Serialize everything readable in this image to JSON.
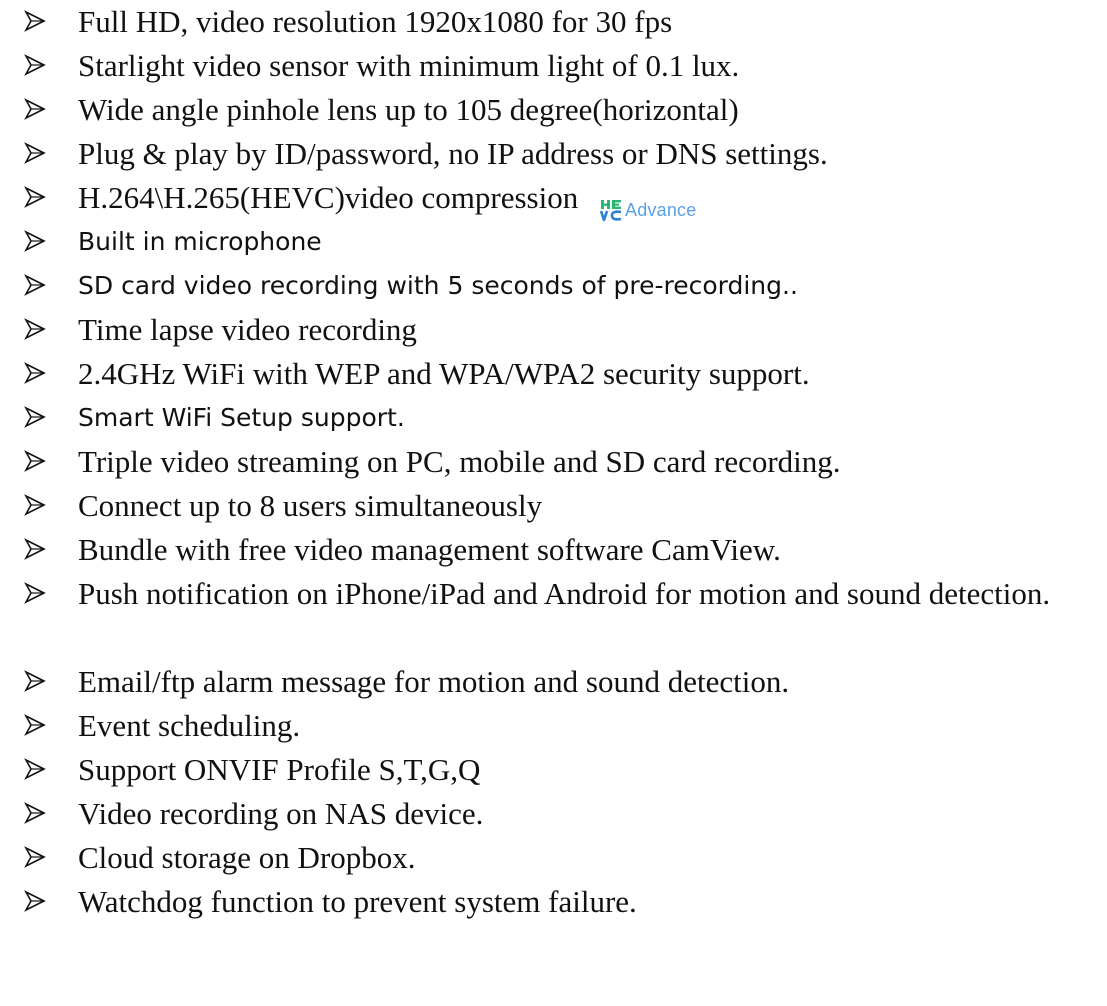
{
  "colors": {
    "text": "#111111",
    "logo_green": "#2bb673",
    "logo_blue": "#5aa0e6"
  },
  "bullet_icon": "arrowhead-bullet-icon",
  "features": [
    {
      "text": "Full HD, video resolution 1920x1080 for 30 fps",
      "style": "serif"
    },
    {
      "text": "Starlight video sensor with minimum light of 0.1 lux.",
      "style": "serif"
    },
    {
      "text": "Wide angle pinhole lens up to 105 degree(horizontal)",
      "style": "serif"
    },
    {
      "text": "Plug & play by ID/password, no IP address or DNS settings.",
      "style": "serif"
    },
    {
      "text": "H.264\\H.265(HEVC)video compression",
      "style": "serif",
      "logo": {
        "icon": "hevc-advance-logo",
        "word": "Advance"
      }
    },
    {
      "text": "Built in microphone",
      "style": "sans"
    },
    {
      "text": "SD card video recording with 5 seconds of pre-recording..",
      "style": "sans"
    },
    {
      "text": "Time lapse video recording",
      "style": "serif"
    },
    {
      "text": "2.4GHz WiFi with WEP and WPA/WPA2 security support.",
      "style": "serif"
    },
    {
      "text": "Smart WiFi Setup support.",
      "style": "sans"
    },
    {
      "text": "Triple video streaming on PC, mobile and SD card recording.",
      "style": "serif"
    },
    {
      "text": "Connect up to 8 users simultaneously",
      "style": "serif"
    },
    {
      "text": "Bundle with free video management software CamView.",
      "style": "serif"
    },
    {
      "text": "Push notification on iPhone/iPad and Android for motion and sound detection.",
      "style": "serif",
      "lines": 2
    },
    {
      "text": "Email/ftp alarm message for motion and sound detection.",
      "style": "serif"
    },
    {
      "text": "Event scheduling.",
      "style": "serif"
    },
    {
      "text": "Support ONVIF Profile S,T,G,Q",
      "style": "serif"
    },
    {
      "text": "Video recording on NAS device.",
      "style": "serif"
    },
    {
      "text": "Cloud storage on Dropbox.",
      "style": "serif"
    },
    {
      "text": "Watchdog function to prevent system failure.",
      "style": "serif"
    }
  ]
}
